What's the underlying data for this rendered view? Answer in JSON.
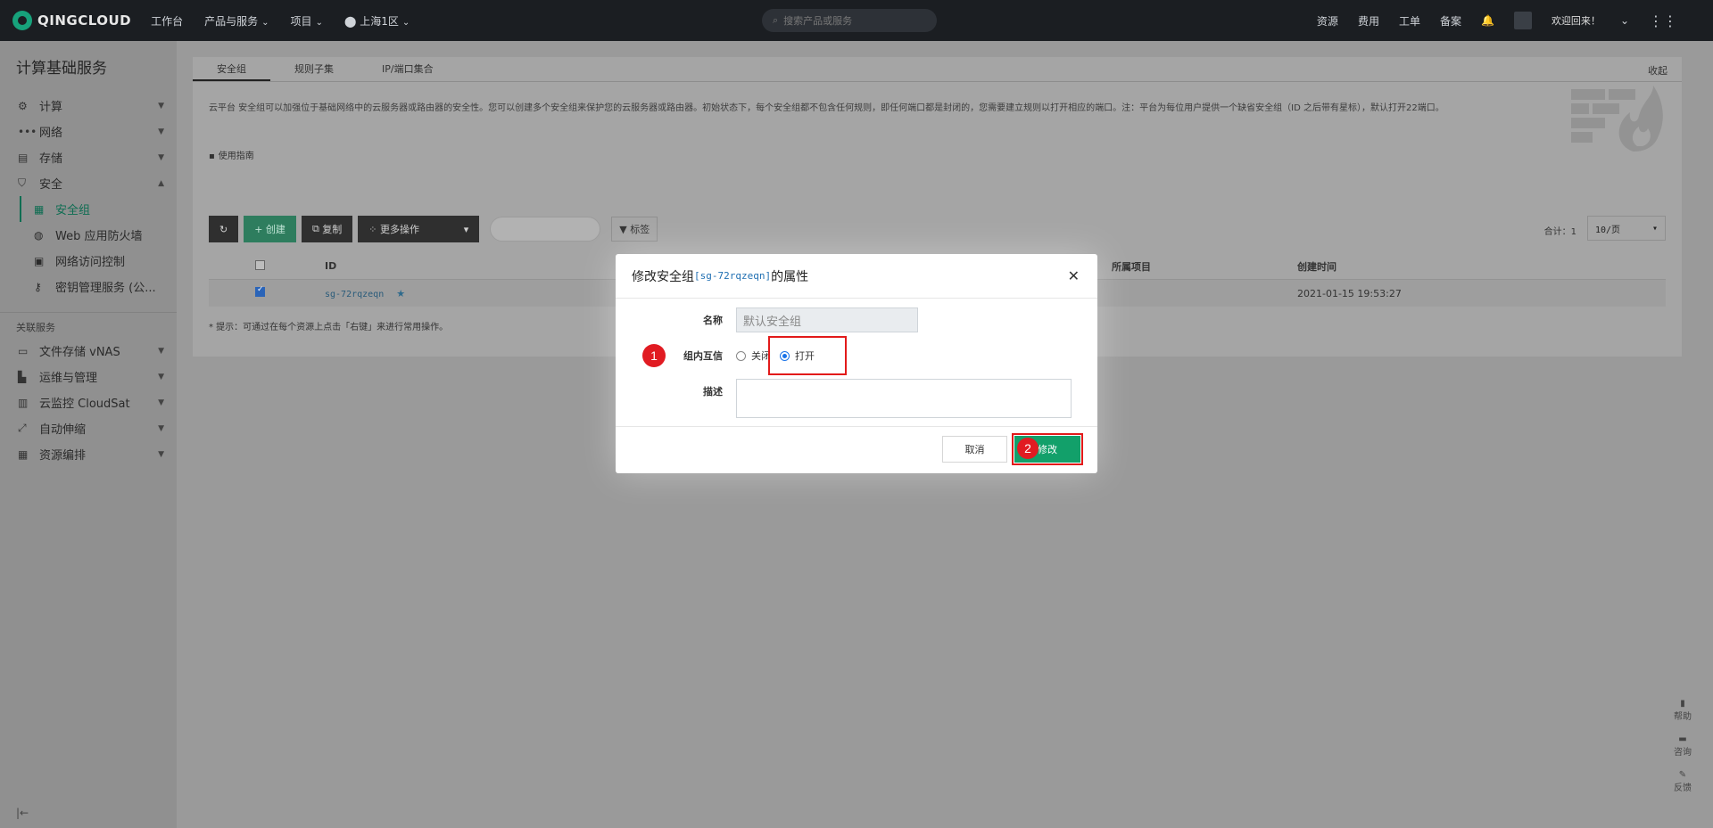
{
  "topbar": {
    "brand": "QINGCLOUD",
    "nav": [
      {
        "label": "工作台",
        "has_chevron": false
      },
      {
        "label": "产品与服务",
        "has_chevron": true
      },
      {
        "label": "项目",
        "has_chevron": true
      },
      {
        "label": "上海1区",
        "has_chevron": true
      }
    ],
    "search_placeholder": "搜索产品或服务",
    "right_links": [
      "资源",
      "费用",
      "工单",
      "备案"
    ],
    "welcome": "欢迎回来！"
  },
  "sidebar": {
    "title": "计算基础服务",
    "items": [
      {
        "label": "计算",
        "icon": "chip-icon",
        "expanded": false
      },
      {
        "label": "网络",
        "icon": "network-icon",
        "expanded": false
      },
      {
        "label": "存储",
        "icon": "storage-icon",
        "expanded": false
      },
      {
        "label": "安全",
        "icon": "shield-icon",
        "expanded": true
      }
    ],
    "sub_items": [
      {
        "label": "安全组",
        "icon": "firewall-icon",
        "active": true
      },
      {
        "label": "Web 应用防火墙",
        "icon": "globe-icon",
        "active": false
      },
      {
        "label": "网络访问控制",
        "icon": "access-control-icon",
        "active": false
      },
      {
        "label": "密钥管理服务 (公...",
        "icon": "key-icon",
        "active": false
      }
    ],
    "related_section": "关联服务",
    "related_items": [
      {
        "label": "文件存储 vNAS",
        "icon": "file-storage-icon"
      },
      {
        "label": "运维与管理",
        "icon": "ops-icon"
      },
      {
        "label": "云监控 CloudSat",
        "icon": "monitor-icon"
      },
      {
        "label": "自动伸缩",
        "icon": "autoscale-icon"
      },
      {
        "label": "资源编排",
        "icon": "orchestration-icon"
      }
    ],
    "collapse_glyph": "|←"
  },
  "main": {
    "tabs": [
      "安全组",
      "规则子集",
      "IP/端口集合"
    ],
    "active_tab": 0,
    "collapse_label": "收起",
    "description": "云平台 安全组可以加强位于基础网络中的云服务器或路由器的安全性。您可以创建多个安全组来保护您的云服务器或路由器。初始状态下，每个安全组都不包含任何规则，即任何端口都是封闭的，您需要建立规则以打开相应的端口。注：平台为每位用户提供一个缺省安全组（ID 之后带有星标），默认打开22端口。",
    "guide_label": "使用指南",
    "toolbar": {
      "create": "+ 创建",
      "copy": "复制",
      "more": "更多操作",
      "tag": "标签"
    },
    "total_label": "合计：1",
    "page_size": "10/页",
    "table": {
      "headers": {
        "id": "ID",
        "project": "所属项目",
        "created": "创建时间"
      },
      "rows": [
        {
          "id": "sg-72rqzeqn",
          "starred": true,
          "created": "2021-01-15 19:53:27",
          "checked": true
        }
      ]
    },
    "tip": "* 提示：可通过在每个资源上点击「右键」来进行常用操作。",
    "floaters": [
      "帮助",
      "咨询",
      "反馈"
    ]
  },
  "modal": {
    "title_prefix": "修改安全组",
    "title_id": "[sg-72rqzeqn]",
    "title_suffix": "的属性",
    "name_label": "名称",
    "name_value": "默认安全组",
    "intra_label": "组内互信",
    "radio_off": "关闭",
    "radio_on": "打开",
    "selected": "打开",
    "desc_label": "描述",
    "desc_value": "",
    "cancel": "取消",
    "ok": "修改"
  },
  "annotations": {
    "step1": "1",
    "step2": "2",
    "highlight_color": "#e21a1a"
  }
}
